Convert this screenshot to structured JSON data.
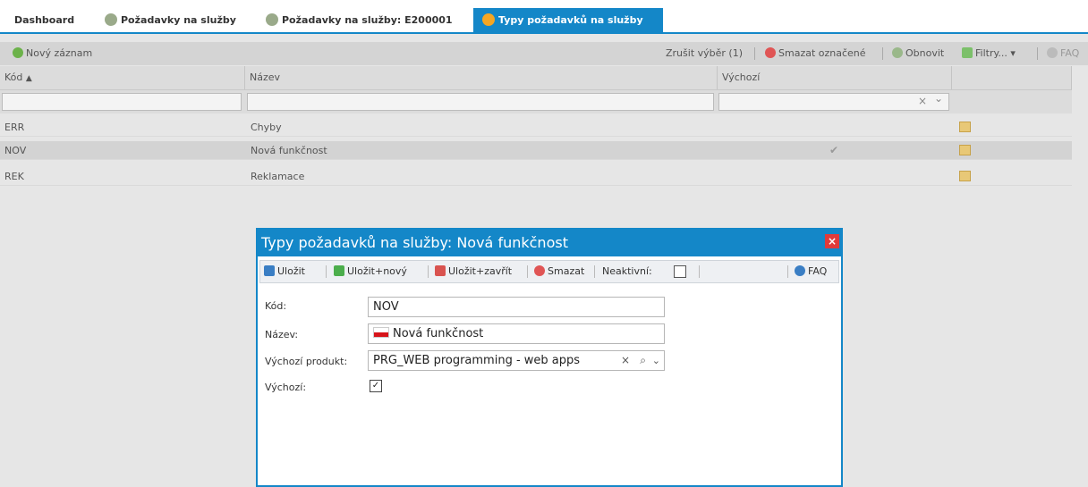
{
  "tabs": [
    {
      "label": "Dashboard"
    },
    {
      "label": "Požadavky na služby"
    },
    {
      "label": "Požadavky na služby: E200001"
    },
    {
      "label": "Typy požadavků na služby"
    }
  ],
  "toolbar": {
    "new_record": "Nový záznam",
    "clear_selection": "Zrušit výběr (1)",
    "delete_marked": "Smazat označené",
    "refresh": "Obnovit",
    "filters": "Filtry...",
    "faq": "FAQ"
  },
  "grid": {
    "columns": [
      "Kód",
      "Název",
      "Výchozí"
    ],
    "rows": [
      {
        "code": "ERR",
        "name": "Chyby",
        "default": false
      },
      {
        "code": "NOV",
        "name": "Nová funkčnost",
        "default": true
      },
      {
        "code": "REK",
        "name": "Reklamace",
        "default": false
      }
    ],
    "filter_clear_glyph": "×",
    "filter_dropdown_glyph": "⌄"
  },
  "dialog": {
    "title": "Typy požadavků na služby: Nová funkčnost",
    "close_glyph": "×",
    "toolbar": {
      "save": "Uložit",
      "save_new": "Uložit+nový",
      "save_close": "Uložit+zavřít",
      "delete": "Smazat",
      "inactive": "Neaktivní:",
      "faq": "FAQ"
    },
    "fields": {
      "code_label": "Kód:",
      "code_value": "NOV",
      "name_label": "Název:",
      "name_value": "Nová funkčnost",
      "product_label": "Výchozí produkt:",
      "product_value": "PRG_WEB programming - web apps",
      "default_label": "Výchozí:",
      "default_checked": true
    }
  },
  "colors": {
    "accent": "#1487c8",
    "selected_row": "#d3d3d3"
  }
}
